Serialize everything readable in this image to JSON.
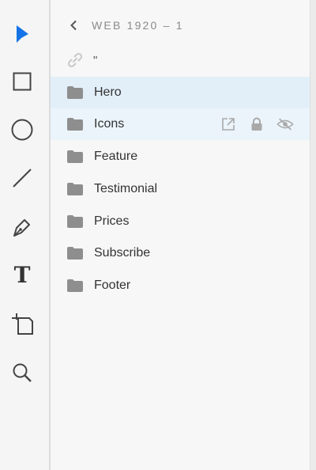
{
  "app": {
    "accent": "#1473e6"
  },
  "toolbar": {
    "tools": [
      {
        "name": "select-tool",
        "icon": "pointer-arrow-icon",
        "active": true
      },
      {
        "name": "rectangle-tool",
        "icon": "rectangle-icon"
      },
      {
        "name": "ellipse-tool",
        "icon": "circle-icon"
      },
      {
        "name": "line-tool",
        "icon": "line-icon"
      },
      {
        "name": "pen-tool",
        "icon": "pen-icon"
      },
      {
        "name": "text-tool",
        "icon": "text-t-icon",
        "glyph": "T"
      },
      {
        "name": "artboard-tool",
        "icon": "artboard-icon"
      },
      {
        "name": "zoom-tool",
        "icon": "magnifier-icon"
      }
    ]
  },
  "layers_panel": {
    "artboard_title": "WEB 1920 – 1",
    "link_label": "\"",
    "layers": [
      {
        "label": "Hero",
        "state": "selected"
      },
      {
        "label": "Icons",
        "state": "hover"
      },
      {
        "label": "Feature"
      },
      {
        "label": "Testimonial"
      },
      {
        "label": "Prices"
      },
      {
        "label": "Subscribe"
      },
      {
        "label": "Footer"
      }
    ],
    "row_actions": [
      "export-icon",
      "lock-icon",
      "hide-eye-icon"
    ]
  }
}
